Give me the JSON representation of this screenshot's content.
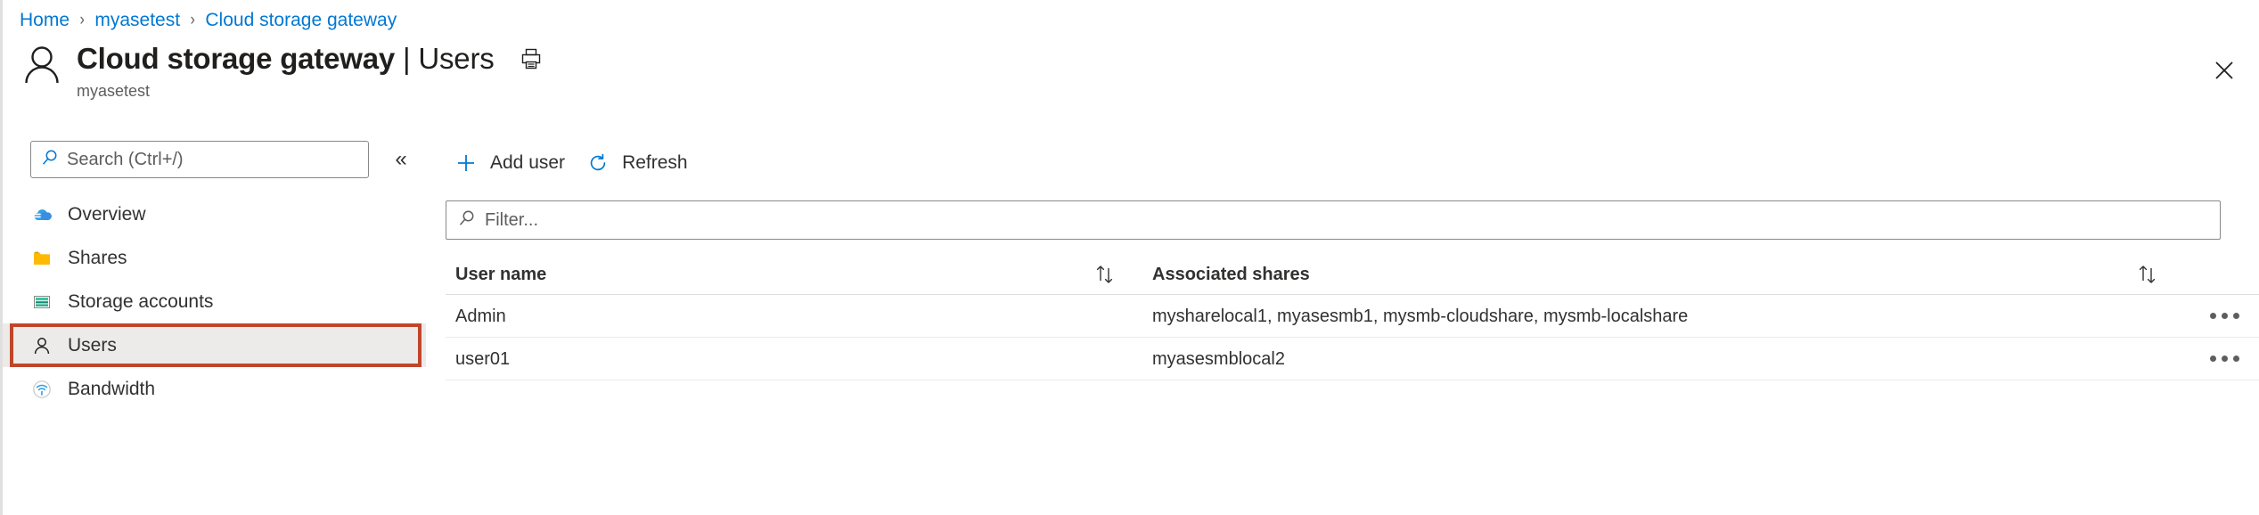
{
  "breadcrumb": {
    "separator": "›",
    "items": [
      {
        "label": "Home"
      },
      {
        "label": "myasetest"
      },
      {
        "label": "Cloud storage gateway"
      }
    ]
  },
  "header": {
    "title_resource": "Cloud storage gateway",
    "title_divider": " | ",
    "title_section": "Users",
    "subtitle": "myasetest",
    "avatar_icon": "person-icon",
    "print_icon": "print-icon",
    "close_icon": "close-icon"
  },
  "sidebar": {
    "search": {
      "placeholder": "Search (Ctrl+/)",
      "value": "",
      "icon": "search-icon"
    },
    "collapse_icon": "chevron-double-left-icon",
    "collapse_glyph": "«",
    "items": [
      {
        "label": "Overview",
        "icon": "cloud-icon",
        "selected": false
      },
      {
        "label": "Shares",
        "icon": "folder-icon",
        "selected": false
      },
      {
        "label": "Storage accounts",
        "icon": "storage-account-icon",
        "selected": false
      },
      {
        "label": "Users",
        "icon": "person-icon",
        "selected": true
      },
      {
        "label": "Bandwidth",
        "icon": "bandwidth-icon",
        "selected": false
      }
    ],
    "highlight_color": "#c0462a"
  },
  "toolbar": {
    "add_user_label": "Add user",
    "add_user_icon": "plus-icon",
    "refresh_label": "Refresh",
    "refresh_icon": "refresh-icon"
  },
  "filter": {
    "placeholder": "Filter...",
    "value": "",
    "icon": "search-icon"
  },
  "table": {
    "columns": [
      {
        "label": "User name",
        "sort_icon": "sort-arrows-icon"
      },
      {
        "label": "Associated shares",
        "sort_icon": "sort-arrows-icon"
      }
    ],
    "rows": [
      {
        "user_name": "Admin",
        "associated_shares": "mysharelocal1, myasesmb1, mysmb-cloudshare, mysmb-localshare",
        "menu_icon": "ellipsis-icon"
      },
      {
        "user_name": "user01",
        "associated_shares": "myasesmblocal2",
        "menu_icon": "ellipsis-icon"
      }
    ]
  },
  "colors": {
    "link": "#0078d4",
    "accent": "#0078d4",
    "selected_bg": "#edebe9",
    "annotation": "#c0462a"
  }
}
